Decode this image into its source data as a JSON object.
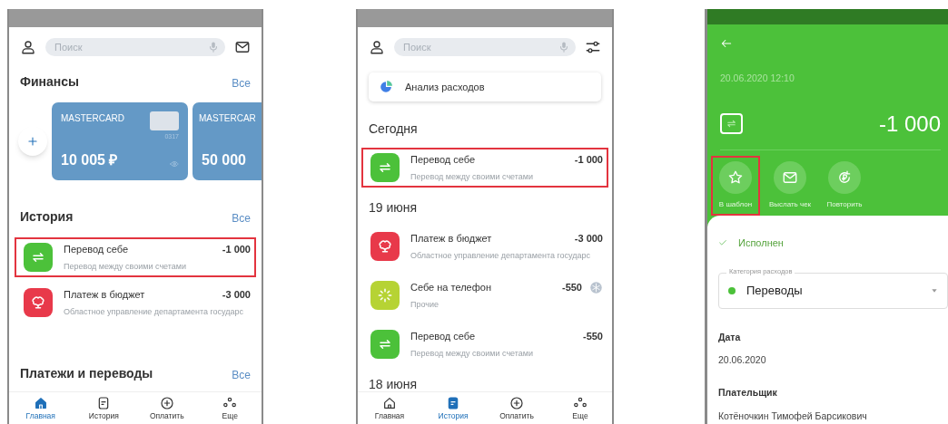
{
  "home_screen": {
    "search": {
      "placeholder": "Поиск"
    },
    "finances": {
      "title": "Финансы",
      "link": "Все",
      "cards": [
        {
          "name": "MASTERCARD",
          "number": "0317",
          "balance": "10 005 ₽"
        },
        {
          "name": "MASTERCAR",
          "balance": "50 000"
        }
      ]
    },
    "history": {
      "title": "История",
      "link": "Все",
      "items": [
        {
          "kind": "transfer",
          "title": "Перевод себе",
          "subtitle": "Перевод между своими счетами",
          "amount": "-1 000",
          "highlighted": true
        },
        {
          "kind": "budget",
          "title": "Платеж в бюджет",
          "subtitle": "Областное управление департамента государс",
          "amount": "-3 000",
          "highlighted": false
        }
      ]
    },
    "payments": {
      "title": "Платежи и переводы",
      "link": "Все"
    },
    "nav": [
      {
        "kind": "home",
        "label": "Главная",
        "selected": true
      },
      {
        "kind": "history",
        "label": "История",
        "selected": false
      },
      {
        "kind": "pay",
        "label": "Оплатить",
        "selected": false
      },
      {
        "kind": "more",
        "label": "Еще",
        "selected": false
      }
    ]
  },
  "history_screen": {
    "search": {
      "placeholder": "Поиск"
    },
    "analysis": "Анализ расходов",
    "groups": [
      {
        "title": "Сегодня",
        "items": [
          {
            "kind": "transfer",
            "title": "Перевод себе",
            "subtitle": "Перевод между своими счетами",
            "amount": "-1 000",
            "highlighted": true,
            "status_icon": false
          }
        ]
      },
      {
        "title": "19 июня",
        "items": [
          {
            "kind": "budget",
            "title": "Платеж в бюджет",
            "subtitle": "Областное управление департамента государс",
            "amount": "-3 000",
            "highlighted": false,
            "status_icon": false
          },
          {
            "kind": "phone",
            "title": "Себе на телефон",
            "subtitle": "Прочие",
            "amount": "-550",
            "highlighted": false,
            "status_icon": true
          },
          {
            "kind": "transfer",
            "title": "Перевод себе",
            "subtitle": "Перевод между своими счетами",
            "amount": "-550",
            "highlighted": false,
            "status_icon": false
          }
        ]
      },
      {
        "title": "18 июня"
      }
    ],
    "nav": [
      {
        "kind": "home",
        "label": "Главная",
        "selected": false
      },
      {
        "kind": "history",
        "label": "История",
        "selected": true
      },
      {
        "kind": "pay",
        "label": "Оплатить",
        "selected": false
      },
      {
        "kind": "more",
        "label": "Еще",
        "selected": false
      }
    ]
  },
  "detail_screen": {
    "datetime": "20.06.2020 12:10",
    "amount": "-1 000",
    "actions": [
      {
        "kind": "star",
        "label": "В шаблон",
        "highlighted": true
      },
      {
        "kind": "mail",
        "label": "Выслать чек",
        "highlighted": false
      },
      {
        "kind": "repeat",
        "label": "Повторить",
        "highlighted": false
      }
    ],
    "status": "Исполнен",
    "category": {
      "label": "Категория расходов",
      "value": "Переводы",
      "color": "#4cc13a"
    },
    "fields": [
      {
        "label": "Дата",
        "value": "20.06.2020"
      },
      {
        "label": "Плательщик",
        "value": "Котёночкин Тимофей Барсикович"
      }
    ]
  }
}
